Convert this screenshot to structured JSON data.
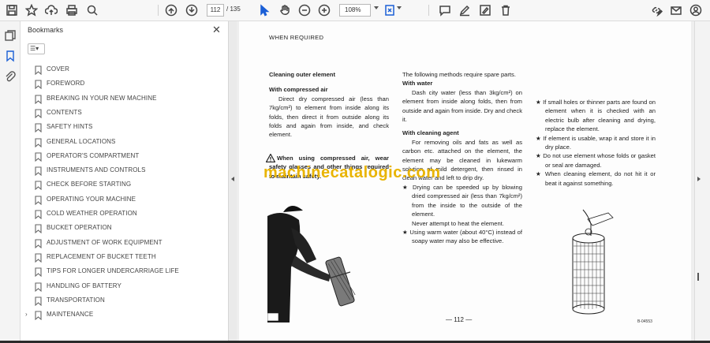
{
  "toolbar": {
    "page_current": "112",
    "page_total": "/ 135",
    "zoom": "108%"
  },
  "panel": {
    "title": "Bookmarks",
    "close_glyph": "✕",
    "options_glyph": "☰▾"
  },
  "bookmarks": [
    {
      "label": "COVER"
    },
    {
      "label": "FOREWORD"
    },
    {
      "label": "BREAKING IN YOUR NEW MACHINE"
    },
    {
      "label": "CONTENTS"
    },
    {
      "label": "SAFETY HINTS"
    },
    {
      "label": "GENERAL LOCATIONS"
    },
    {
      "label": "OPERATOR'S COMPARTMENT"
    },
    {
      "label": "INSTRUMENTS AND CONTROLS"
    },
    {
      "label": "CHECK BEFORE STARTING"
    },
    {
      "label": "OPERATING YOUR MACHINE"
    },
    {
      "label": "COLD WEATHER OPERATION"
    },
    {
      "label": "BUCKET OPERATION"
    },
    {
      "label": "ADJUSTMENT OF WORK EQUIPMENT"
    },
    {
      "label": "REPLACEMENT OF BUCKET TEETH"
    },
    {
      "label": "TIPS FOR LONGER UNDERCARRIAGE LIFE"
    },
    {
      "label": "HANDLING OF BATTERY"
    },
    {
      "label": "TRANSPORTATION"
    },
    {
      "label": "MAINTENANCE",
      "expander": "›"
    }
  ],
  "document": {
    "header": "WHEN REQUIRED",
    "col1": {
      "heading": "Cleaning outer element",
      "sub": "With compressed air",
      "body": "Direct dry compressed air (less than 7kg/cm²) to element from inside along its folds, then direct it from outside along its folds and again from inside, and check element.",
      "warning": "When using compressed air, wear safety glasses and other things required to maintain safety."
    },
    "col2": {
      "intro": "The following methods require spare parts.",
      "sub1": "With water",
      "body1": "Dash city water (less than 3kg/cm²) on element from inside along folds, then from outside and again from inside. Dry and check it.",
      "sub2": "With cleaning agent",
      "body2": "For removing oils and fats as well as carbon etc. attached on the element, the element may be cleaned in lukewarm solution of mild detergent, then rinsed in clean water and left to drip dry.",
      "star1": "★  Drying can be speeded up by blowing dried compressed air (less than 7kg/cm²) from the inside to the outside of the element.",
      "never": "Never attempt to heat the element.",
      "star2": "★  Using warm water (about 40°C) instead of soapy water may also be effective."
    },
    "col3": {
      "star1": "★  If small holes or thinner parts are found on element when it is checked with an electric bulb after cleaning and drying, replace the element.",
      "star2": "★  If element is usable, wrap it and store it in dry place.",
      "star3": "★  Do not use element whose folds or gasket or seal are damaged.",
      "star4": "★  When cleaning element, do not hit it or beat it against something."
    },
    "page_number": "— 112 —",
    "figure_code": "B-04553",
    "watermark": "machinecatalogic.com"
  },
  "icons": {
    "warning": "warning-triangle-icon"
  }
}
